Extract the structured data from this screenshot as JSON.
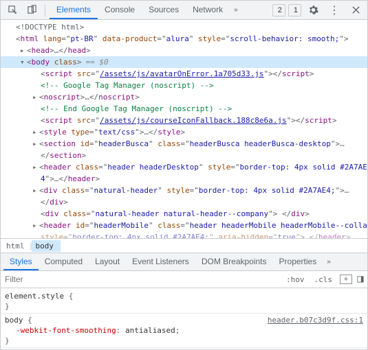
{
  "toolbar": {
    "tabs": [
      "Elements",
      "Console",
      "Sources",
      "Network"
    ],
    "active": 0,
    "warnCount": "2",
    "infoCount": "1"
  },
  "dom": {
    "doctype": "<!DOCTYPE html>",
    "htmlOpen": {
      "tag": "html",
      "attrs": "lang=\"pt-BR\" data-product=\"alura\" style=\"scroll-behavior: smooth;\""
    },
    "head": {
      "tag": "head"
    },
    "bodyOpen": {
      "tag": "body",
      "attrs": "class",
      "pill": "== $0"
    },
    "script1": {
      "tag": "script",
      "srcPrefix": "src=\"",
      "link": "/assets/js/avatarOnError.1a705d33.js",
      "srcSuffix": "\""
    },
    "comment1": " Google Tag Manager (noscript) ",
    "noscript": {
      "tag": "noscript"
    },
    "comment2": " End Google Tag Manager (noscript) ",
    "script2": {
      "tag": "script",
      "srcPrefix": "src=\"",
      "link": "/assets/js/courseIconFallback.188c8e6a.js",
      "srcSuffix": "\""
    },
    "style": {
      "tag": "style",
      "attrs": "type=\"text/css\""
    },
    "section": {
      "tag": "section",
      "attrs": "id=\"headerBusca\" class=\"headerBusca headerBusca-desktop\""
    },
    "header1a": {
      "tag": "header",
      "attrs": "class=\"header headerDesktop\" style=\"border-top: 4px solid #2A7AE"
    },
    "header1b": "4\"",
    "div1": {
      "tag": "div",
      "attrs": "class=\"natural-header\" style=\"border-top: 4px solid #2A7AE4;\""
    },
    "div2": {
      "tag": "div",
      "attrs": "class=\"natural-header natural-header--company\""
    },
    "header2": {
      "tag": "header",
      "attrs": "id=\"headerMobile\" class=\"header headerMobile headerMobile--colla"
    },
    "header2b": "style=\"border-top: 4px solid #2A7AE4;\" aria-hidden=\"true\""
  },
  "crumbs": [
    "html",
    "body"
  ],
  "stylesTabs": [
    "Styles",
    "Computed",
    "Layout",
    "Event Listeners",
    "DOM Breakpoints",
    "Properties"
  ],
  "filterPlaceholder": "Filter",
  "hov": ":hov",
  "cls": ".cls",
  "rules": {
    "r1sel": "element.style",
    "r2sel": "body",
    "r2src": "header.b07c3d9f.css:1",
    "r2pname": "-webkit-font-smoothing",
    "r2pval": "antialiased"
  }
}
